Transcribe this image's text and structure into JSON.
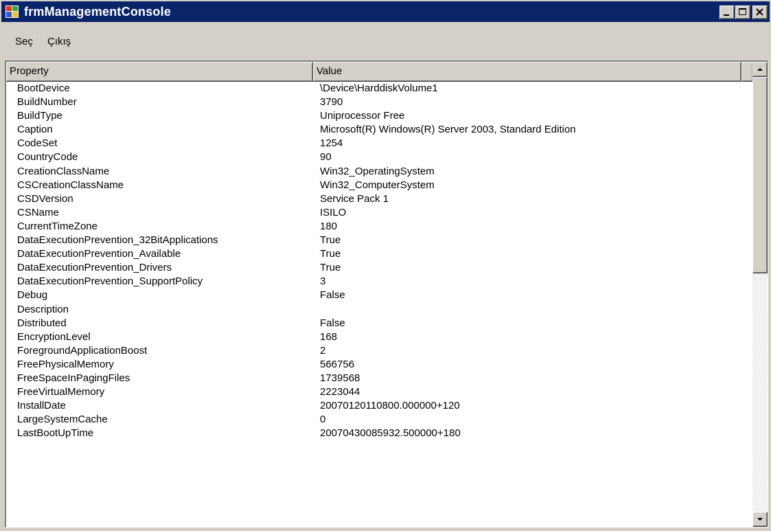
{
  "window": {
    "title": "frmManagementConsole",
    "app_icon": "windows-flag-icon",
    "controls": {
      "minimize": "minimize-icon",
      "maximize": "maximize-icon",
      "close": "close-icon"
    }
  },
  "menu": {
    "items": [
      {
        "label": "Seç"
      },
      {
        "label": "Çıkış"
      }
    ]
  },
  "list": {
    "columns": {
      "property": "Property",
      "value": "Value"
    },
    "rows": [
      {
        "property": "BootDevice",
        "value": "\\Device\\HarddiskVolume1"
      },
      {
        "property": "BuildNumber",
        "value": "3790"
      },
      {
        "property": "BuildType",
        "value": "Uniprocessor Free"
      },
      {
        "property": "Caption",
        "value": "Microsoft(R) Windows(R) Server 2003, Standard Edition"
      },
      {
        "property": "CodeSet",
        "value": "1254"
      },
      {
        "property": "CountryCode",
        "value": "90"
      },
      {
        "property": "CreationClassName",
        "value": "Win32_OperatingSystem"
      },
      {
        "property": "CSCreationClassName",
        "value": "Win32_ComputerSystem"
      },
      {
        "property": "CSDVersion",
        "value": "Service Pack 1"
      },
      {
        "property": "CSName",
        "value": "ISILO"
      },
      {
        "property": "CurrentTimeZone",
        "value": "180"
      },
      {
        "property": "DataExecutionPrevention_32BitApplications",
        "value": "True"
      },
      {
        "property": "DataExecutionPrevention_Available",
        "value": "True"
      },
      {
        "property": "DataExecutionPrevention_Drivers",
        "value": "True"
      },
      {
        "property": "DataExecutionPrevention_SupportPolicy",
        "value": "3"
      },
      {
        "property": "Debug",
        "value": "False"
      },
      {
        "property": "Description",
        "value": ""
      },
      {
        "property": "Distributed",
        "value": "False"
      },
      {
        "property": "EncryptionLevel",
        "value": "168"
      },
      {
        "property": "ForegroundApplicationBoost",
        "value": "2"
      },
      {
        "property": "FreePhysicalMemory",
        "value": "566756"
      },
      {
        "property": "FreeSpaceInPagingFiles",
        "value": "1739568"
      },
      {
        "property": "FreeVirtualMemory",
        "value": "2223044"
      },
      {
        "property": "InstallDate",
        "value": "20070120110800.000000+120"
      },
      {
        "property": "LargeSystemCache",
        "value": "0"
      },
      {
        "property": "LastBootUpTime",
        "value": "20070430085932.500000+180"
      }
    ]
  },
  "scrollbar": {
    "up": "scroll-up-arrow-icon",
    "down": "scroll-down-arrow-icon"
  },
  "colors": {
    "titlebar": "#0a246a",
    "face": "#d4d0c8",
    "list_background": "#ffffff"
  }
}
